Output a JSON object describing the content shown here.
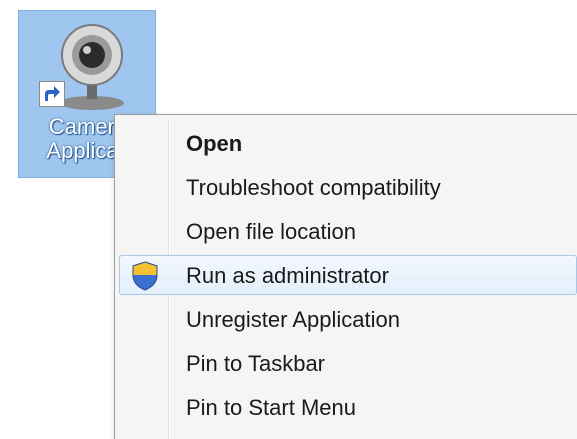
{
  "desktop": {
    "shortcut": {
      "label_line1": "Camera",
      "label_line2": "Applicati",
      "icon": "webcam-icon",
      "overlay_icon": "shortcut-arrow-icon"
    }
  },
  "context_menu": {
    "items": [
      {
        "label": "Open",
        "bold": true
      },
      {
        "label": "Troubleshoot compatibility"
      },
      {
        "label": "Open file location"
      },
      {
        "label": "Run as administrator",
        "icon": "uac-shield-icon",
        "highlighted": true
      },
      {
        "label": "Unregister Application"
      },
      {
        "label": "Pin to Taskbar"
      },
      {
        "label": "Pin to Start Menu"
      }
    ]
  },
  "colors": {
    "selection_bg": "#9ec6ee",
    "menu_bg": "#f5f5f5",
    "highlight_border": "#a8c8ea"
  }
}
